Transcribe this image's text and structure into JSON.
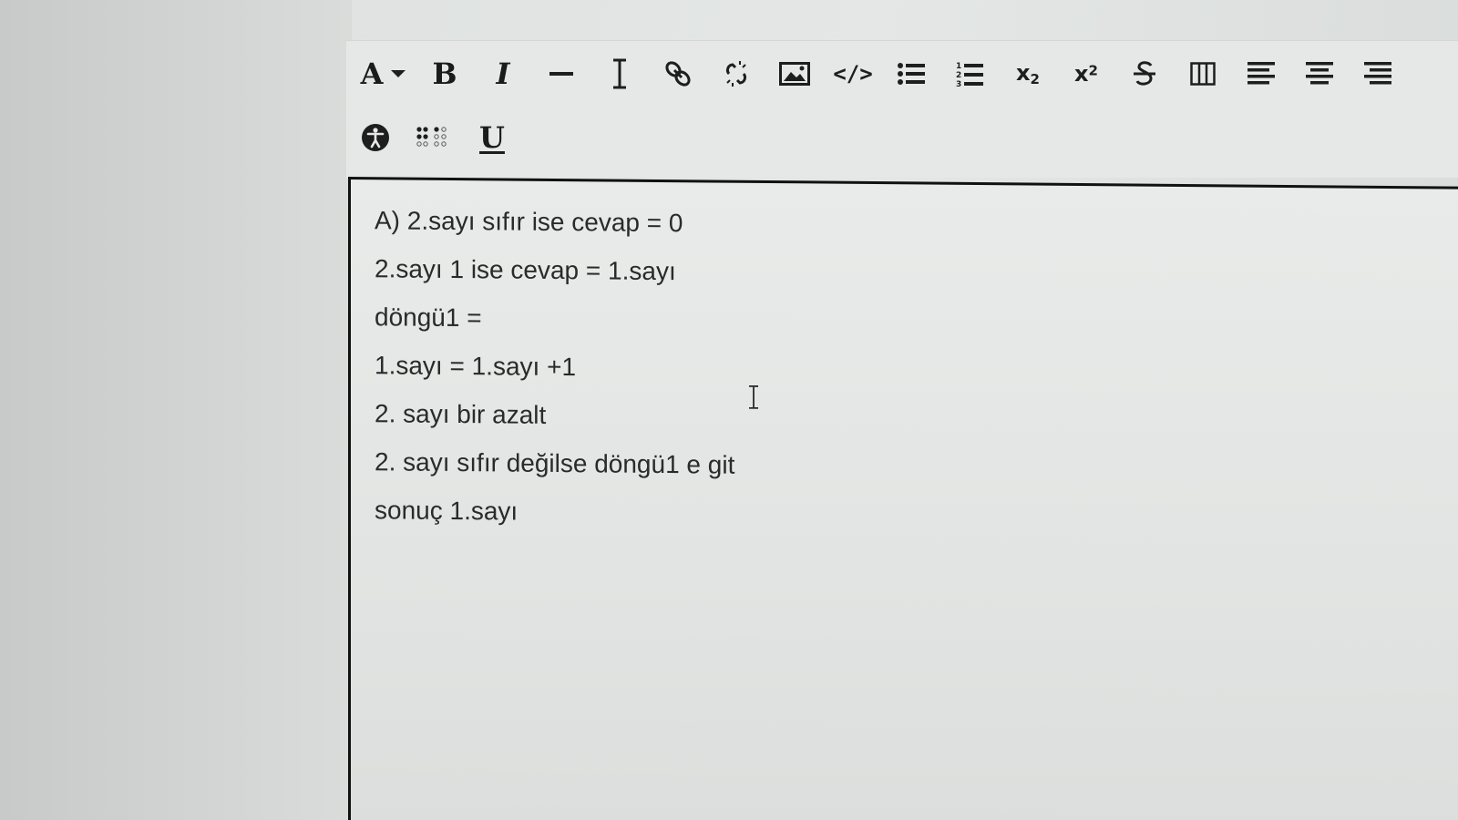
{
  "toolbar": {
    "row1": [
      {
        "name": "font-color-dropdown",
        "glyph": "A",
        "icon": "font-color-icon"
      },
      {
        "name": "bold-button",
        "glyph": "B",
        "icon": "bold-icon"
      },
      {
        "name": "italic-button",
        "glyph": "I",
        "icon": "italic-icon"
      },
      {
        "name": "horizontal-rule-button",
        "icon": "horizontal-rule-icon"
      },
      {
        "name": "text-cursor-button",
        "icon": "ibeam-icon"
      },
      {
        "name": "insert-link-button",
        "icon": "link-icon"
      },
      {
        "name": "remove-link-button",
        "icon": "unlink-icon"
      },
      {
        "name": "insert-image-button",
        "icon": "image-icon"
      },
      {
        "name": "code-view-button",
        "glyph": "</>",
        "icon": "code-icon"
      },
      {
        "name": "bullet-list-button",
        "icon": "bullet-list-icon"
      },
      {
        "name": "numbered-list-button",
        "icon": "numbered-list-icon"
      },
      {
        "name": "subscript-button",
        "icon": "subscript-icon"
      },
      {
        "name": "superscript-button",
        "icon": "superscript-icon"
      },
      {
        "name": "strikethrough-button",
        "icon": "strikethrough-icon"
      },
      {
        "name": "table-button",
        "icon": "table-columns-icon"
      },
      {
        "name": "align-left-button",
        "icon": "align-left-icon"
      },
      {
        "name": "align-center-button",
        "icon": "align-center-icon"
      },
      {
        "name": "align-right-button",
        "icon": "align-right-icon"
      }
    ],
    "row2": [
      {
        "name": "accessibility-button",
        "icon": "accessibility-icon"
      },
      {
        "name": "braille-button",
        "icon": "braille-icon"
      },
      {
        "name": "underline-button",
        "glyph": "U",
        "icon": "underline-icon"
      }
    ],
    "labels": {
      "font_color": "A",
      "bold": "B",
      "italic": "I",
      "underline": "U",
      "code": "</>",
      "subscript_base": "x",
      "subscript_index": "2",
      "superscript_base": "x",
      "superscript_index": "2"
    }
  },
  "editor": {
    "lines": [
      "A) 2.sayı sıfır ise cevap = 0",
      "2.sayı 1 ise cevap = 1.sayı",
      "döngü1 =",
      "1.sayı = 1.sayı +1",
      "2. sayı bir azalt",
      "2. sayı sıfır değilse döngü1 e git",
      "sonuç 1.sayı"
    ]
  },
  "colors": {
    "background": "#e2e4e3",
    "text": "#2a2a2a",
    "icon": "#1e1e1e",
    "editor_border": "#111111"
  }
}
